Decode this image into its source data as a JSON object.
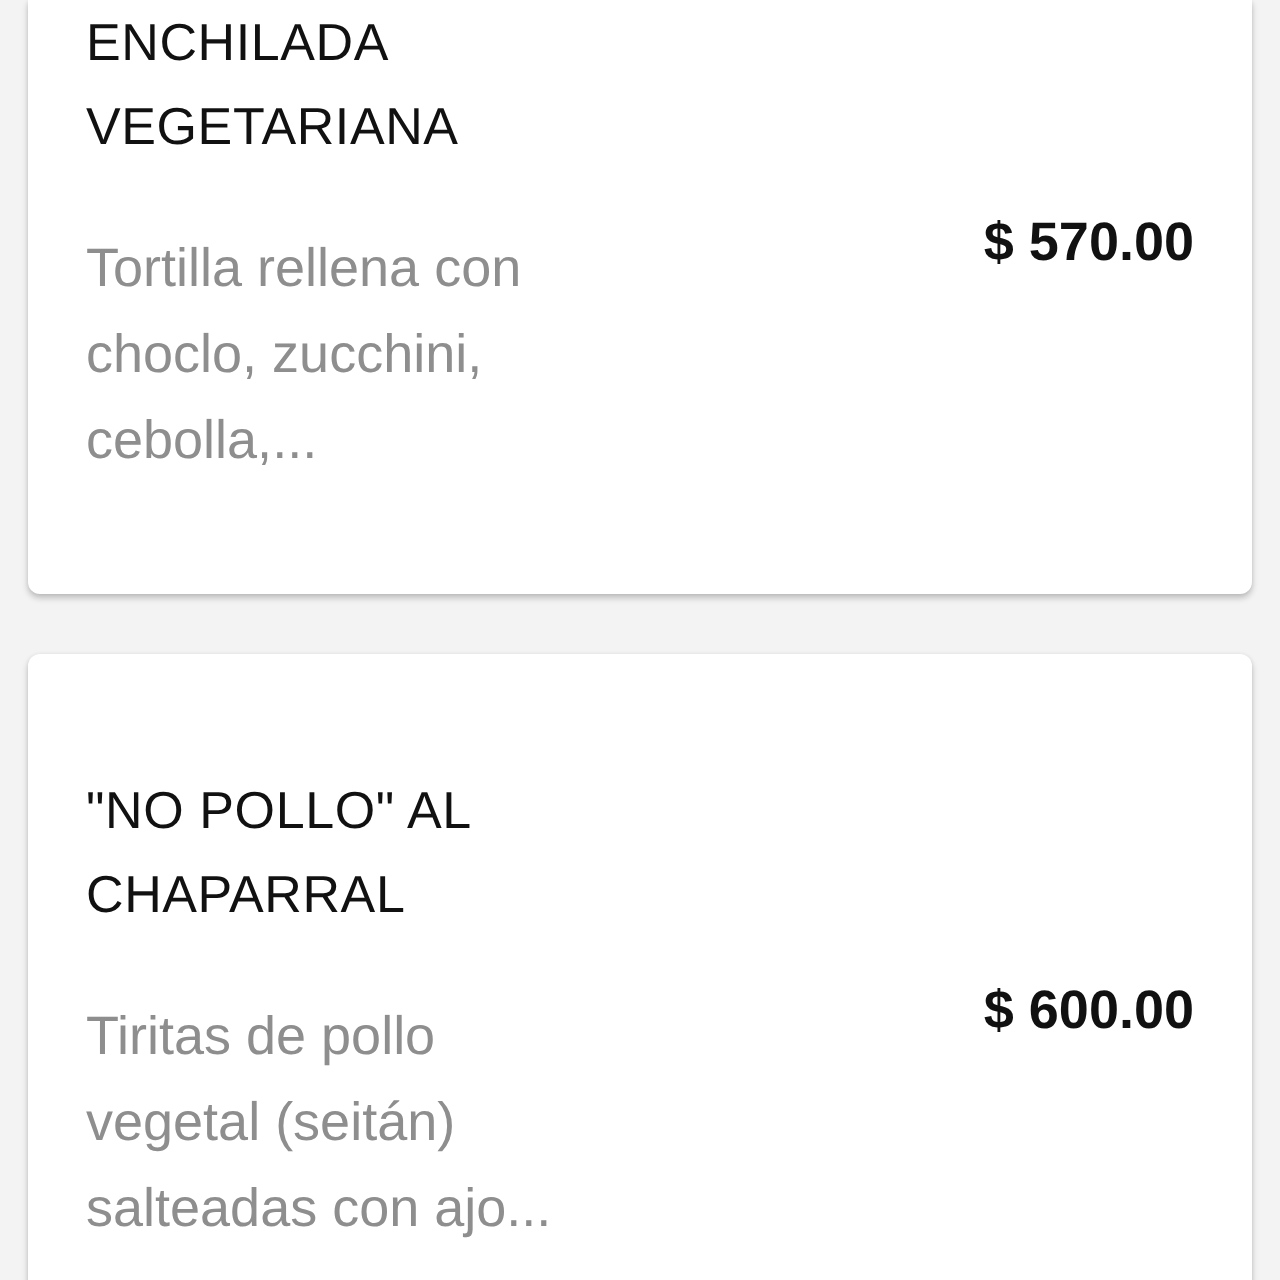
{
  "items": [
    {
      "name": "ENCHILADA VEGETARIANA",
      "description": "Tortilla rellena con choclo, zucchini, cebolla,...",
      "price": "$ 570.00"
    },
    {
      "name": "\"NO POLLO\" AL CHAPARRAL",
      "description": "Tiritas de pollo vegetal (seitán) salteadas con ajo...",
      "price": "$ 600.00"
    }
  ]
}
